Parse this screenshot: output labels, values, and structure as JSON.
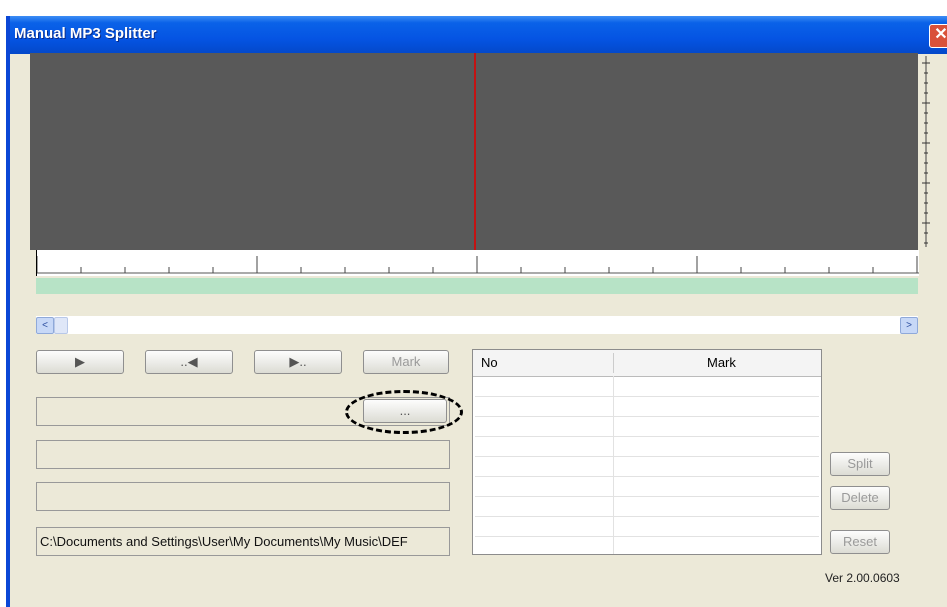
{
  "window": {
    "title": "Manual MP3 Splitter",
    "close_glyph": "✕"
  },
  "waveform": {
    "background_color": "#595959",
    "playhead_color": "#c41212",
    "progress_bar_color": "#b7e3c6"
  },
  "scrollbar": {
    "left_glyph": "<",
    "right_glyph": ">"
  },
  "controls": {
    "play_icon": "▶",
    "prev_icon": "..◀",
    "next_icon": "▶..",
    "mark_label": "Mark",
    "browse_label": "...",
    "split_label": "Split",
    "delete_label": "Delete",
    "reset_label": "Reset"
  },
  "fields": {
    "file_path": "",
    "field_2": "",
    "field_3": "",
    "output_path": "C:\\Documents and Settings\\User\\My Documents\\My Music\\DEF"
  },
  "mark_table": {
    "columns": [
      "No",
      "Mark"
    ],
    "rows": []
  },
  "version": "Ver 2.00.0603"
}
